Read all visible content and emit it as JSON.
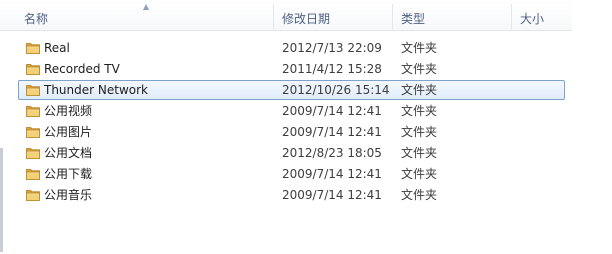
{
  "columns": {
    "name": "名称",
    "date_modified": "修改日期",
    "type": "类型",
    "size": "大小"
  },
  "sort_indicator": "ascending",
  "icon": "folder-icon",
  "accent_color": "#7da2ce",
  "files": [
    {
      "name": "Real",
      "date": "2012/7/13 22:09",
      "type": "文件夹",
      "selected": false
    },
    {
      "name": "Recorded TV",
      "date": "2011/4/12 15:28",
      "type": "文件夹",
      "selected": false
    },
    {
      "name": "Thunder Network",
      "date": "2012/10/26 15:14",
      "type": "文件夹",
      "selected": true
    },
    {
      "name": "公用视频",
      "date": "2009/7/14 12:41",
      "type": "文件夹",
      "selected": false
    },
    {
      "name": "公用图片",
      "date": "2009/7/14 12:41",
      "type": "文件夹",
      "selected": false
    },
    {
      "name": "公用文档",
      "date": "2012/8/23 18:05",
      "type": "文件夹",
      "selected": false
    },
    {
      "name": "公用下载",
      "date": "2009/7/14 12:41",
      "type": "文件夹",
      "selected": false
    },
    {
      "name": "公用音乐",
      "date": "2009/7/14 12:41",
      "type": "文件夹",
      "selected": false
    }
  ]
}
